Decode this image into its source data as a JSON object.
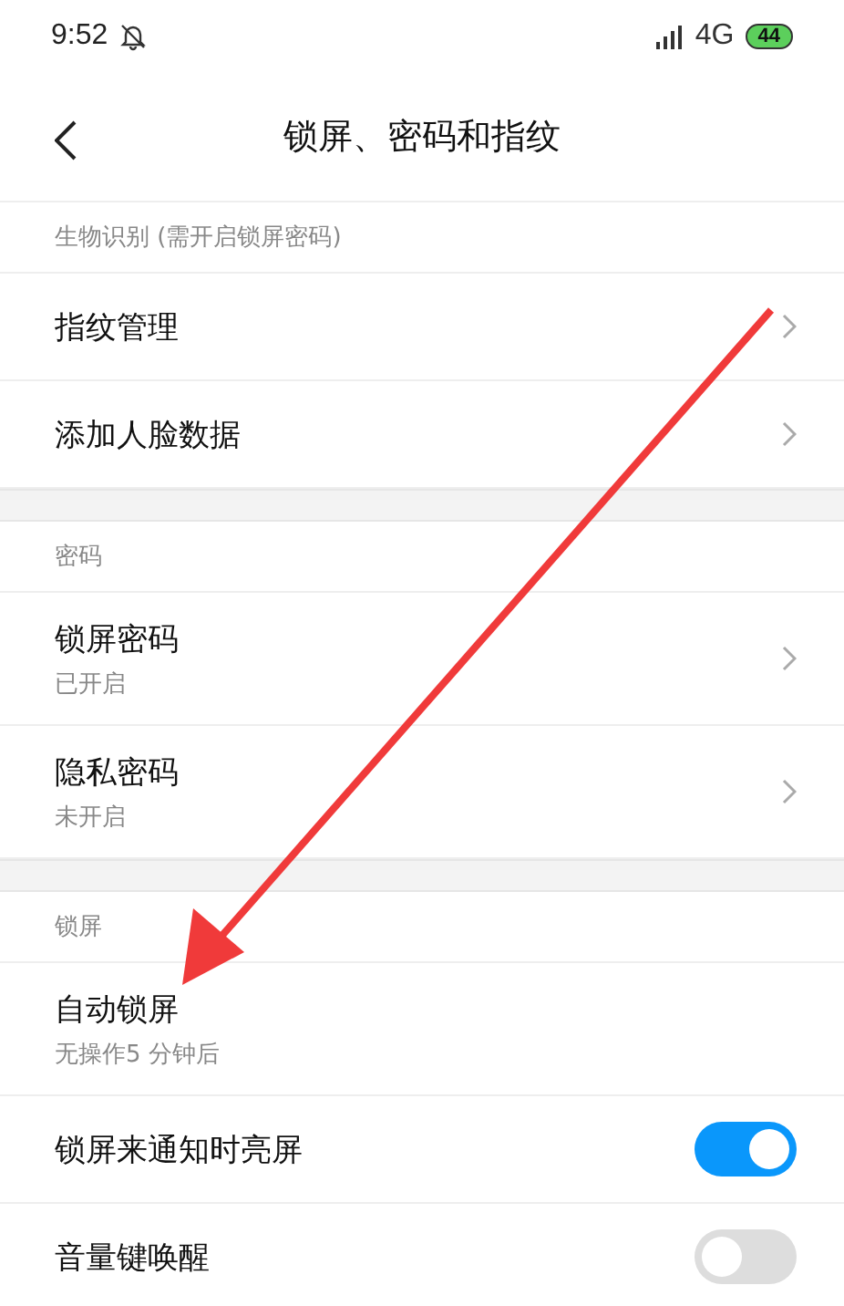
{
  "status_bar": {
    "time": "9:52",
    "network": "4G",
    "battery": "44"
  },
  "header": {
    "title": "锁屏、密码和指纹"
  },
  "sections": [
    {
      "title": "生物识别 (需开启锁屏密码)",
      "rows": [
        {
          "kind": "link",
          "label": "指纹管理"
        },
        {
          "kind": "link",
          "label": "添加人脸数据"
        }
      ]
    },
    {
      "title": "密码",
      "rows": [
        {
          "kind": "link",
          "label": "锁屏密码",
          "subtitle": "已开启"
        },
        {
          "kind": "link",
          "label": "隐私密码",
          "subtitle": "未开启"
        }
      ]
    },
    {
      "title": "锁屏",
      "rows": [
        {
          "kind": "plain",
          "label": "自动锁屏",
          "subtitle": "无操作5 分钟后"
        },
        {
          "kind": "toggle",
          "label": "锁屏来通知时亮屏",
          "on": true
        },
        {
          "kind": "toggle",
          "label": "音量键唤醒",
          "on": false
        }
      ]
    }
  ]
}
